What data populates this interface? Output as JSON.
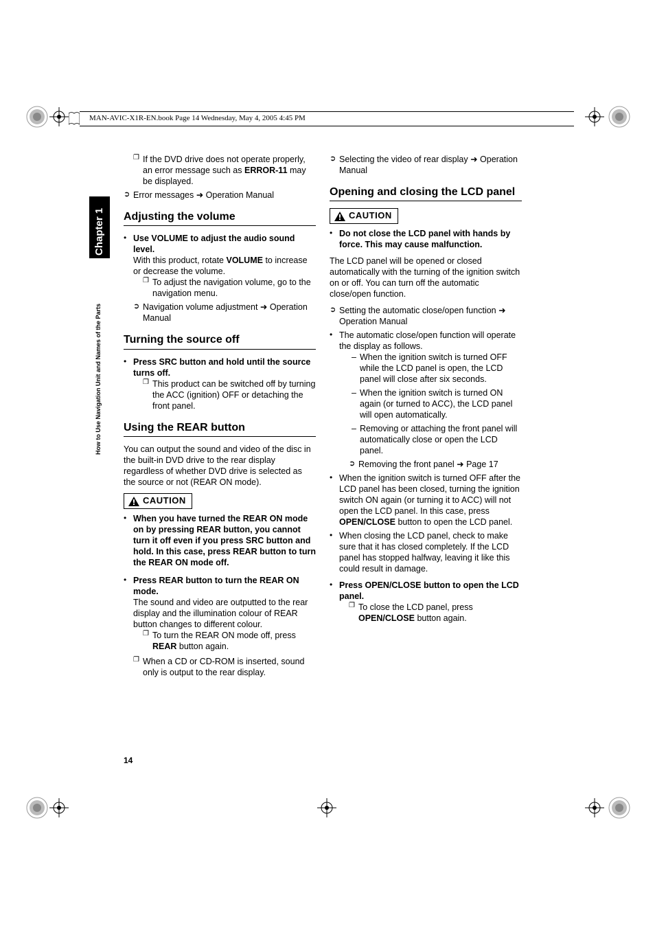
{
  "header": "MAN-AVIC-X1R-EN.book  Page 14  Wednesday, May 4, 2005  4:45 PM",
  "sidebar": {
    "chapter": "Chapter 1",
    "section_label": "How to Use Navigation Unit and Names of the Parts"
  },
  "page_number": "14",
  "caution_label": "CAUTION",
  "left": {
    "intro_sq": "If the DVD drive does not operate properly, an error message such as ",
    "intro_sq_bold": "ERROR-11",
    "intro_sq_after": " may be displayed.",
    "intro_arrow": "Error messages ➜ Operation Manual",
    "h_adjust": "Adjusting the volume",
    "adjust_b1_bold": "Use VOLUME to adjust the audio sound level.",
    "adjust_b1_p1a": "With this product, rotate ",
    "adjust_b1_p1b": "VOLUME",
    "adjust_b1_p1c": " to increase or decrease the volume.",
    "adjust_sq": "To adjust the navigation volume, go to the navigation menu.",
    "adjust_arrow": "Navigation volume adjustment ➜ Operation Manual",
    "h_turn": "Turning the source off",
    "turn_b1_bold": "Press SRC button and hold until the source turns off.",
    "turn_sq": "This product can be switched off by turning the ACC (ignition) OFF or detaching the front panel.",
    "h_rear": "Using the REAR button",
    "rear_p1": "You can output the sound and video of the disc in the built-in DVD drive to the rear display regardless of whether DVD drive is selected as the source or not (REAR ON mode).",
    "rear_caution": "When you have turned the REAR ON mode on by pressing REAR button, you cannot turn it off even if you press SRC button and hold. In this case, press REAR button to turn the REAR ON mode off.",
    "rear_b1_bold": "Press REAR button to turn the REAR ON mode.",
    "rear_b1_p": "The sound and video are outputted to the rear display and the illumination colour of REAR button changes to different colour.",
    "rear_sq1a": "To turn the REAR ON mode off, press ",
    "rear_sq1b": "REAR",
    "rear_sq1c": " button again.",
    "rear_sq2": "When a CD or CD-ROM is inserted, sound only is output to the rear display."
  },
  "right": {
    "intro_arrow": "Selecting the video of rear display ➜ Operation Manual",
    "h_open": "Opening and closing the LCD panel",
    "open_caution": "Do not close the LCD panel with hands by force. This may cause malfunction.",
    "open_p1": "The LCD panel will be opened or closed automatically with the turning of the ignition switch on or off. You can turn off the automatic close/open function.",
    "open_arrow1": "Setting the automatic close/open function ➜ Operation Manual",
    "open_b1": "The automatic close/open function will operate the display as follows.",
    "open_d1": "When the ignition switch is turned OFF while the LCD panel is open, the LCD panel will close after six seconds.",
    "open_d2": "When the ignition switch is turned ON again (or turned to ACC), the LCD panel will open automatically.",
    "open_d3": "Removing or attaching the front panel will automatically close or open the LCD panel.",
    "open_arrow2": "Removing the front panel ➜ Page 17",
    "open_b2a": "When the ignition switch is turned OFF after the LCD panel has been closed, turning the ignition switch ON again (or turning it to ACC) will not open the LCD panel. In this case, press ",
    "open_b2b": "OPEN/CLOSE",
    "open_b2c": " button to open the LCD panel.",
    "open_b3": "When closing the LCD panel, check to make sure that it has closed completely. If the LCD panel has stopped halfway, leaving it like this could result in damage.",
    "open_bold": "Press OPEN/CLOSE button to open the LCD panel.",
    "open_sq1a": "To close the LCD panel, press ",
    "open_sq1b": "OPEN/CLOSE",
    "open_sq1c": " button again."
  }
}
